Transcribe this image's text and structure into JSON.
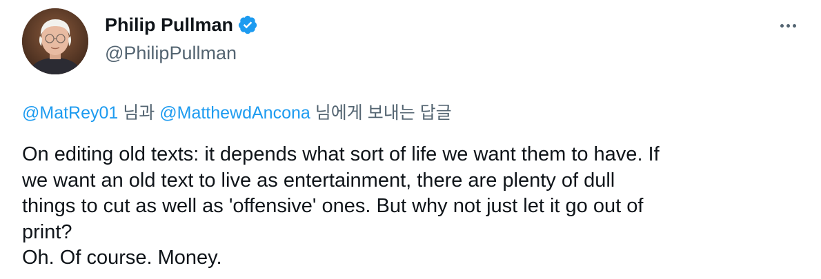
{
  "author": {
    "display_name": "Philip Pullman",
    "handle": "@PhilipPullman",
    "verified_icon": "verified-badge-icon",
    "avatar": "profile-photo"
  },
  "header": {
    "more_icon": "more-options-icon"
  },
  "reply_context": {
    "mention_1": "@MatRey01",
    "connector": " 님과 ",
    "mention_2": "@MatthewdAncona",
    "suffix": " 님에게 보내는 답글"
  },
  "tweet": {
    "lines": [
      "On editing old texts: it depends what sort of life we want them to have. If",
      "we want an old text to live as entertainment, there are plenty of dull",
      "things to cut as well as 'offensive' ones. But why not just let it go out of",
      "print?",
      "Oh. Of course. Money."
    ]
  },
  "colors": {
    "link": "#1d9bf0",
    "secondary_text": "#536471",
    "primary_text": "#0f1419",
    "verified": "#1d9bf0"
  }
}
